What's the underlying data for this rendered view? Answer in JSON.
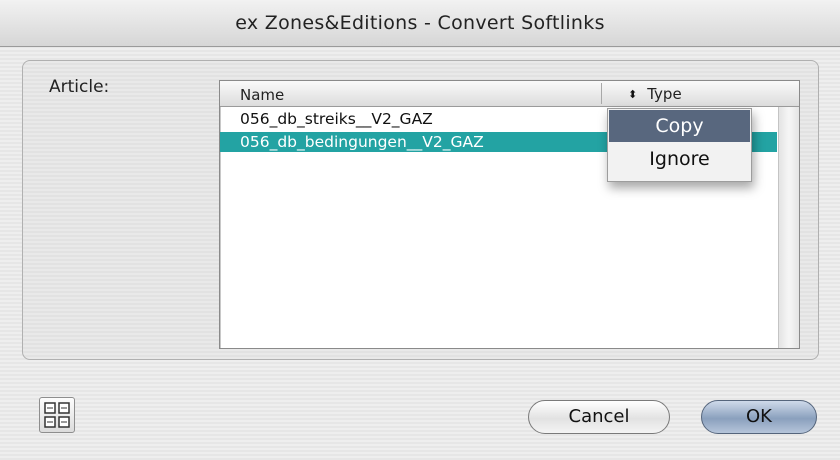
{
  "window": {
    "title": "ex Zones&Editions - Convert Softlinks"
  },
  "form": {
    "article_label": "Article:"
  },
  "list": {
    "columns": [
      "Name",
      "Type"
    ],
    "rows": [
      {
        "name": "056_db_streiks__V2_GAZ",
        "selected": false
      },
      {
        "name": "056_db_bedingungen__V2_GAZ",
        "selected": true
      }
    ]
  },
  "popup": {
    "options": [
      "Copy",
      "Ignore"
    ],
    "highlighted": "Copy"
  },
  "buttons": {
    "cancel": "Cancel",
    "ok": "OK"
  },
  "icons": {
    "sort": "sort-arrows-icon",
    "layout": "grid-layout-icon"
  },
  "colors": {
    "selection": "#23a3a3",
    "menu_highlight": "#58677e",
    "default_button": "#8aa0bd"
  }
}
